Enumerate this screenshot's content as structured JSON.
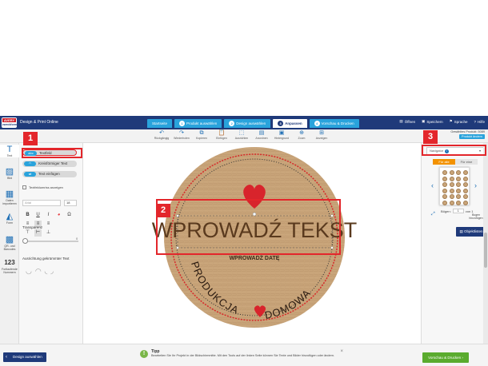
{
  "app": {
    "logo_top": "AVERY",
    "logo_bottom": "zweckform",
    "title": "Design & Print Online"
  },
  "steps": [
    {
      "num": "",
      "label": "Startseite",
      "active": false
    },
    {
      "num": "1",
      "label": "Produkt auswählen",
      "active": false
    },
    {
      "num": "2",
      "label": "Design auswählen",
      "active": false
    },
    {
      "num": "3",
      "label": "Anpassen",
      "active": true
    },
    {
      "num": "4",
      "label": "Vorschau & Drucken",
      "active": false
    }
  ],
  "nav": {
    "open": "Öffnen",
    "save": "Speichern",
    "language": "Sprache",
    "help": "Hilfe"
  },
  "toolbar": {
    "tools": [
      {
        "icon": "↶",
        "label": "Rückgängig"
      },
      {
        "icon": "↷",
        "label": "Wiederholen"
      },
      {
        "icon": "⧉",
        "label": "Kopieren"
      },
      {
        "icon": "📋",
        "label": "Einfügen"
      },
      {
        "icon": "⬚",
        "label": "Ausrichten"
      },
      {
        "icon": "▤",
        "label": "Anordnen"
      },
      {
        "icon": "▣",
        "label": "Hintergrund"
      },
      {
        "icon": "⊕",
        "label": "Zoom"
      },
      {
        "icon": "⊞",
        "label": "Anzeigen"
      }
    ],
    "product_label": "Gewähltes Produkt: 5089",
    "product_button": "Produkt ändern"
  },
  "rail": [
    {
      "icon": "T",
      "label": "Text",
      "name": "text",
      "active": true
    },
    {
      "icon": "▨",
      "label": "Bild",
      "name": "image",
      "active": false
    },
    {
      "icon": "▦",
      "label": "Daten importieren",
      "name": "data-import",
      "active": false
    },
    {
      "icon": "◭",
      "label": "Form",
      "name": "shape",
      "active": false
    },
    {
      "icon": "▩",
      "label": "QR- und Barcodes",
      "name": "qr-barcode",
      "active": false
    },
    {
      "icon": "123",
      "label": "Fortlaufende Nummern",
      "name": "serial-numbers",
      "active": false
    }
  ],
  "panel": {
    "btn_textfield": "Textfeld",
    "btn_textfield_icon": "abc",
    "btn_circular": "Kreisförmiger Text",
    "btn_insert": "Text einfügen",
    "checkbox_label": "Textfeldumriss anzeigen",
    "font_name": "Arial",
    "font_size": "18",
    "fmt_bold": "B",
    "fmt_underline": "U",
    "fmt_italic": "I",
    "fmt_omega": "Ω",
    "transparency_label": "Transparenz",
    "transparency_value": "0",
    "arc_label": "Ausrichtung gekrümmter Text"
  },
  "label": {
    "main_text": "WPROWADŹ TEKST",
    "date_text": "WPROWADŹ DATĘ",
    "arc_text_left": "PRODUKCJA",
    "arc_text_right": "DOMOWA"
  },
  "annotations": {
    "tag1": "1",
    "tag2": "2",
    "tag3": "3"
  },
  "right": {
    "navigator": "Navigator",
    "tab_all": "Für alle",
    "tab_one": "Für eine",
    "page_label": "Bögen:",
    "page_value": "1",
    "page_of": "von 1",
    "add_sheet": "Bogen hinzufügen",
    "objects_button": "Objektlisten"
  },
  "footer": {
    "back": "Design auswählen",
    "tip_title": "Tipp",
    "tip_text": "Bearbeiten Sie Ihr Projekt in der Bildschirmmitte. Mit den Tools auf der linken Seite können Sie Texte und Bilder hinzufügen oder ändern.",
    "next": "Vorschau & Drucken"
  },
  "colors": {
    "brand": "#1f3a7a",
    "step": "#29a3dc",
    "accent": "#e3262b",
    "kraft": "#c9a57a",
    "next": "#5aab2e"
  }
}
